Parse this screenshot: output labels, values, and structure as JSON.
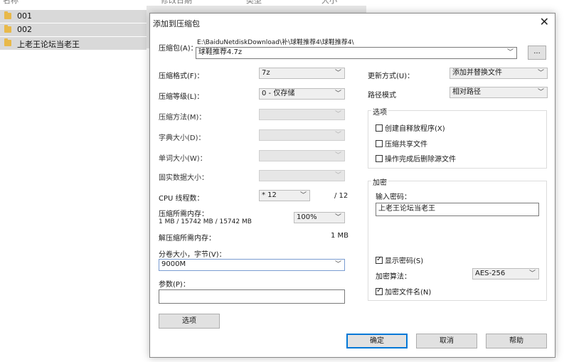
{
  "background": {
    "header": [
      "名称",
      "修改日期",
      "类型",
      "大小"
    ],
    "files": [
      "001",
      "002",
      "上老王论坛当老王"
    ]
  },
  "dialog": {
    "title": "添加到压缩包",
    "close_glyph": "✕",
    "archive_label": "压缩包(A)：",
    "archive_path": "E:\\BaiduNetdiskDownload\\补\\球鞋推荐4\\球鞋推荐4\\",
    "archive_name": "球鞋推荐4.7z",
    "browse_label": "...",
    "format_label": "压缩格式(F)：",
    "format_value": "7z",
    "level_label": "压缩等级(L)：",
    "level_value": "0 - 仅存储",
    "method_label": "压缩方法(M)：",
    "dict_label": "字典大小(D)：",
    "word_label": "单词大小(W)：",
    "solid_label": "固实数据大小：",
    "cpu_label": "CPU 线程数：",
    "cpu_value": "* 12",
    "cpu_max": "/ 12",
    "mem_label": "压缩所需内存：",
    "mem_value": "1 MB / 15742 MB / 15742 MB",
    "mem_percent": "100%",
    "decomp_label": "解压缩所需内存：",
    "decomp_value": "1 MB",
    "split_label": "分卷大小，字节(V)：",
    "split_value": "9000M",
    "params_label": "参数(P)：",
    "params_value": "",
    "options_button": "选项",
    "update_label": "更新方式(U)：",
    "update_value": "添加并替换文件",
    "path_label": "路径模式",
    "path_value": "相对路径",
    "options_group": {
      "title": "选项",
      "sfx": "创建自释放程序(X)",
      "shared": "压缩共享文件",
      "delete": "操作完成后删除源文件"
    },
    "encryption": {
      "title": "加密",
      "password_label": "输入密码：",
      "password_value": "上老王论坛当老王",
      "show_password": "显示密码(S)",
      "method_label": "加密算法：",
      "method_value": "AES-256",
      "encrypt_names": "加密文件名(N)"
    },
    "ok": "确定",
    "cancel": "取消",
    "help": "帮助"
  }
}
